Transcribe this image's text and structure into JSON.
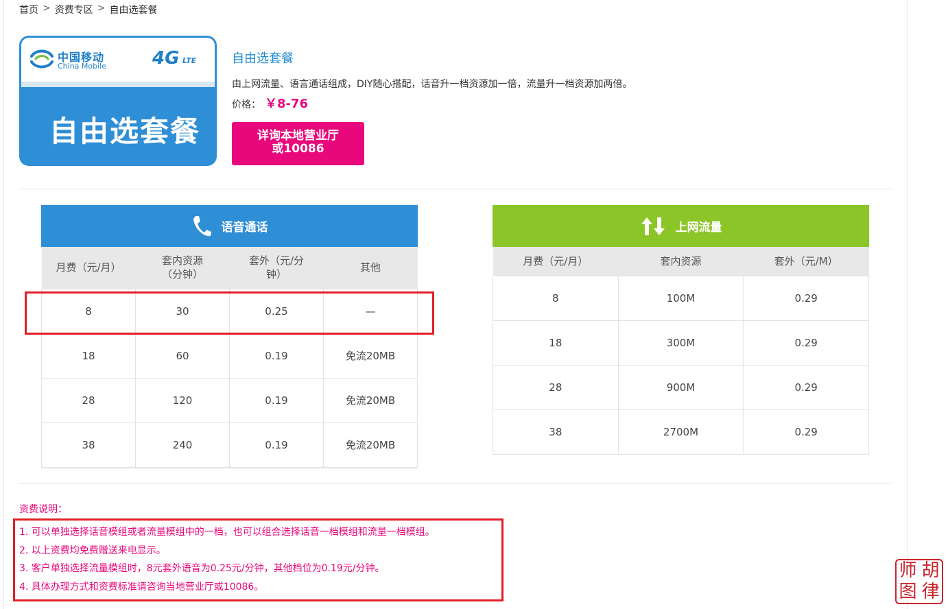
{
  "breadcrumb": {
    "items": [
      "首页",
      "资费专区",
      "自由选套餐"
    ],
    "separator": ">"
  },
  "card": {
    "brand_cn": "中国移动",
    "brand_en": "China Mobile",
    "network": "4G",
    "network_sub": "LTE",
    "title": "自由选套餐"
  },
  "product": {
    "title": "自由选套餐",
    "description": "由上网流量、语言通话组成，DIY随心搭配，话音升一档资源加一倍，流量升一档资源加两倍。",
    "price_label": "价格：",
    "price_value": "￥8-76",
    "cta_line1": "详询本地营业厅",
    "cta_line2": "或10086"
  },
  "voice_table": {
    "title": "语音通话",
    "icon": "phone-icon",
    "color": "#2e8ed6",
    "headers": [
      "月费（元/月）",
      "套内资源（分钟）",
      "套外（元/分钟）",
      "其他"
    ],
    "rows": [
      [
        "8",
        "30",
        "0.25",
        "—"
      ],
      [
        "18",
        "60",
        "0.19",
        "免流20MB"
      ],
      [
        "28",
        "120",
        "0.19",
        "免流20MB"
      ],
      [
        "38",
        "240",
        "0.19",
        "免流20MB"
      ]
    ]
  },
  "data_table": {
    "title": "上网流量",
    "icon": "up-down-arrows-icon",
    "color": "#8cc527",
    "headers": [
      "月费（元/月）",
      "套内资源",
      "套外（元/M）"
    ],
    "rows": [
      [
        "8",
        "100M",
        "0.29"
      ],
      [
        "18",
        "300M",
        "0.29"
      ],
      [
        "28",
        "900M",
        "0.29"
      ],
      [
        "38",
        "2700M",
        "0.29"
      ]
    ]
  },
  "notes": {
    "title": "资费说明：",
    "items": [
      "1. 可以单独选择话音模组或者流量模组中的一档，也可以组合选择话音一档模组和流量一档模组。",
      "2. 以上资费均免费赠送来电显示。",
      "3. 客户单独选择流量模组时，8元套外语音为0.25元/分钟，其他档位为0.19元/分钟。",
      "4. 具体办理方式和资费标准请咨询当地营业厅或10086。"
    ]
  },
  "stamp": {
    "chars": [
      "胡",
      "律",
      "师",
      "图"
    ]
  },
  "colors": {
    "accent_pink": "#e8087c",
    "accent_blue": "#1f8bd2",
    "highlight_red": "#e11d25"
  }
}
